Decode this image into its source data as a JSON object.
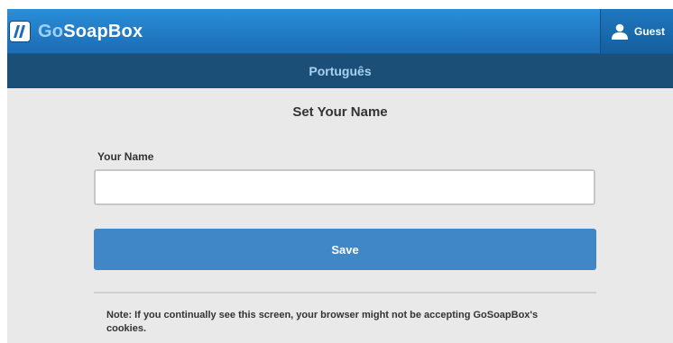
{
  "header": {
    "logo_go": "Go",
    "logo_rest": "SoapBox",
    "logo_icon": "soapbox-logo-icon",
    "user_icon": "user-icon",
    "user_label": "Guest",
    "accent_color": "#1b6cb4"
  },
  "language_bar": {
    "language": "Português",
    "background_color": "#1b4f77"
  },
  "form": {
    "title": "Set Your Name",
    "name_label": "Your Name",
    "name_value": "",
    "name_placeholder": "",
    "save_label": "Save",
    "button_color": "#3f87c7"
  },
  "note": {
    "text": "Note: If you continually see this screen, your browser might not be accepting GoSoapBox's cookies."
  }
}
